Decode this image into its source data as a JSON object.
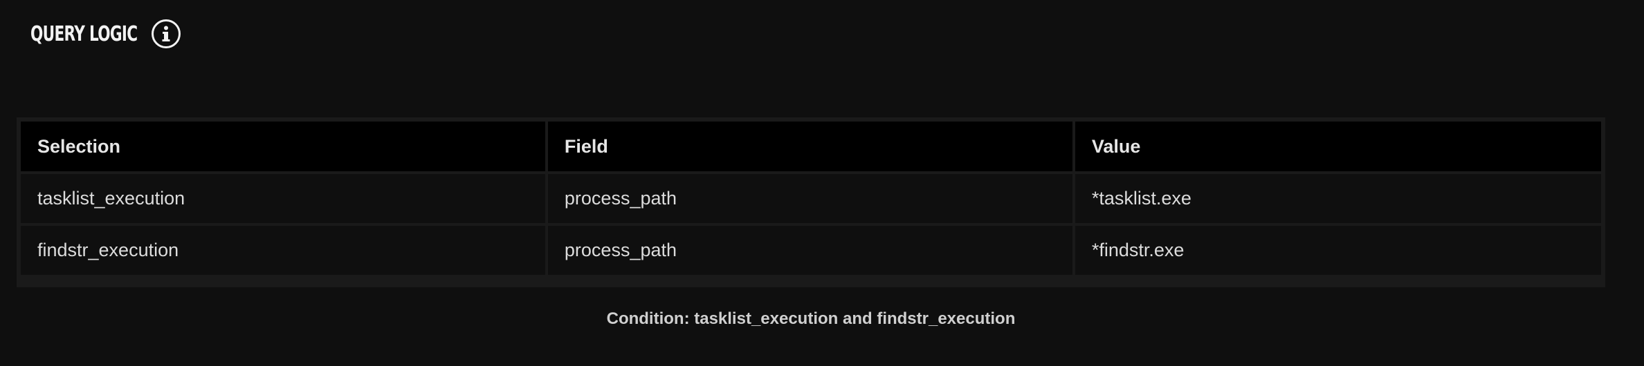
{
  "header": {
    "title": "QUERY LOGIC",
    "info_icon": "info-icon"
  },
  "table": {
    "columns": [
      "Selection",
      "Field",
      "Value"
    ],
    "rows": [
      [
        "tasklist_execution",
        "process_path",
        "*tasklist.exe"
      ],
      [
        "findstr_execution",
        "process_path",
        "*findstr.exe"
      ]
    ]
  },
  "condition": "Condition: tasklist_execution and findstr_execution",
  "colors": {
    "background": "#0f0f0f",
    "header_cell": "#000000",
    "grid": "#1a1a1a",
    "text": "#dcdcdc"
  }
}
